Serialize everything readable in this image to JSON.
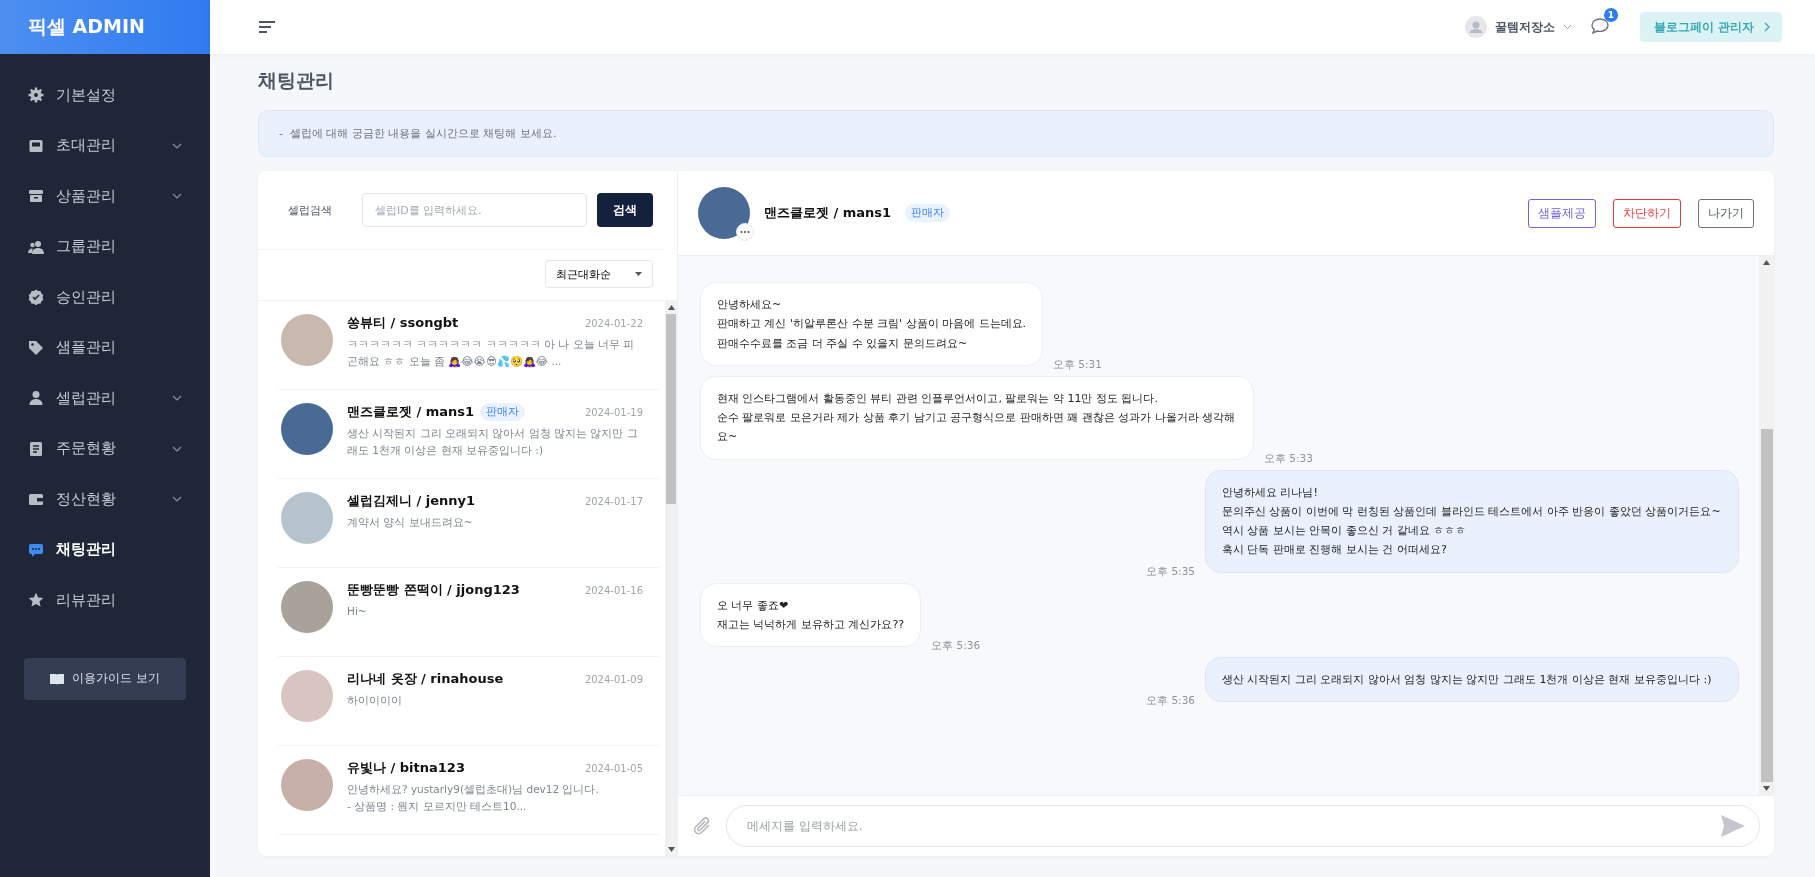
{
  "logo": "픽셀 ADMIN",
  "sidebar": {
    "items": [
      {
        "label": "기본설정",
        "expandable": false,
        "selected": false
      },
      {
        "label": "초대관리",
        "expandable": true,
        "selected": false
      },
      {
        "label": "상품관리",
        "expandable": true,
        "selected": false
      },
      {
        "label": "그룹관리",
        "expandable": false,
        "selected": false
      },
      {
        "label": "승인관리",
        "expandable": false,
        "selected": false
      },
      {
        "label": "샘플관리",
        "expandable": false,
        "selected": false
      },
      {
        "label": "셀럽관리",
        "expandable": true,
        "selected": false
      },
      {
        "label": "주문현황",
        "expandable": true,
        "selected": false
      },
      {
        "label": "정산현황",
        "expandable": true,
        "selected": false
      },
      {
        "label": "채팅관리",
        "expandable": false,
        "selected": true
      },
      {
        "label": "리뷰관리",
        "expandable": false,
        "selected": false
      }
    ],
    "guide_button": "이용가이드 보기"
  },
  "header": {
    "user": "꿀템저장소",
    "notification_count": "1",
    "admin_button": "블로그페이 관리자"
  },
  "page_title": "채팅관리",
  "notice": "-  셀럽에 대해 궁금한 내용을 실시간으로 채팅해 보세요.",
  "search": {
    "label": "셀럽검색",
    "placeholder": "셀럽ID를 입력하세요.",
    "button": "검색",
    "sort": "최근대화순"
  },
  "conversations": [
    {
      "name": "쏭뷰티 / ssongbt",
      "date": "2024-01-22",
      "preview": "ㅋㅋㅋㅋㅋㅋ ㅋㅋㅋㅋㅋㅋ ㅋㅋㅋㅋㅋ 아 나 오늘 너무 피곤해요 ㅎㅎ 오늘 좀 🙇‍♀️😂😭😎💦🥺🙇‍♀️😂 ..."
    },
    {
      "name": "맨즈클로젯 / mans1",
      "badge": "판매자",
      "date": "2024-01-19",
      "preview": "생산 시작된지 그리 오래되지 않아서 엄청 많지는 않지만 그래도 1천개 이상은 현재 보유중입니다 :)"
    },
    {
      "name": "셀럽김제니 / jenny1",
      "date": "2024-01-17",
      "preview": "계약서 양식 보내드려요~"
    },
    {
      "name": "뚠빵뚠빵 쫀떡이 / jjong123",
      "date": "2024-01-16",
      "preview": "Hi~"
    },
    {
      "name": "리나네 옷장 / rinahouse",
      "date": "2024-01-09",
      "preview": "하이이이이"
    },
    {
      "name": "유빛나 / bitna123",
      "date": "2024-01-05",
      "preview": "안녕하세요? yustarly9(셀럽초대)님 dev12 입니다.\n- 상품명 : 뭔지 모르지만 테스트10..."
    }
  ],
  "chat": {
    "title": "맨즈클로젯 / mans1",
    "badge": "판매자",
    "buttons": [
      {
        "label": "샘플제공",
        "kind": "primary"
      },
      {
        "label": "차단하기",
        "kind": "danger"
      },
      {
        "label": "나가기",
        "kind": "neutral"
      }
    ],
    "messages": [
      {
        "kind": "received",
        "text": "안녕하세요~\n판매하고 계신 '히알루론산 수분 크림' 상품이 마음에 드는데요.\n판매수수료를 조금 더 주실 수 있을지 문의드려요~",
        "time": "오후 5:31"
      },
      {
        "kind": "received",
        "text": "현재 인스타그램에서 활동중인 뷰티 관련 인플루언서이고, 팔로워는 약 11만 정도 됩니다.\n순수 팔로워로 모은거라 제가 상품 후기 남기고 공구형식으로 판매하면 꽤 괜찮은 성과가 나올거라 생각해요~",
        "time": "오후 5:33"
      },
      {
        "kind": "sent",
        "text": "안녕하세요 리나님!\n문의주신 상품이 이번에 막 런칭된 상품인데 블라인드 테스트에서 아주 반응이 좋았던 상품이거든요~\n역시 상품 보시는 안목이 좋으신 거 같네요 ㅎㅎㅎ\n혹시 단독 판매로 진행해 보시는 건 어떠세요?",
        "time": "오후 5:35"
      },
      {
        "kind": "received",
        "text": "오 너무 좋죠❤\n재고는 넉넉하게 보유하고 계신가요??",
        "time": "오후 5:36"
      },
      {
        "kind": "sent",
        "text": "생산 시작된지 그리 오래되지 않아서 엄청 많지는 않지만 그래도 1천개 이상은 현재 보유중입니다 :)",
        "time": "오후 5:36"
      }
    ],
    "input_placeholder": "메세지를 입력하세요."
  }
}
